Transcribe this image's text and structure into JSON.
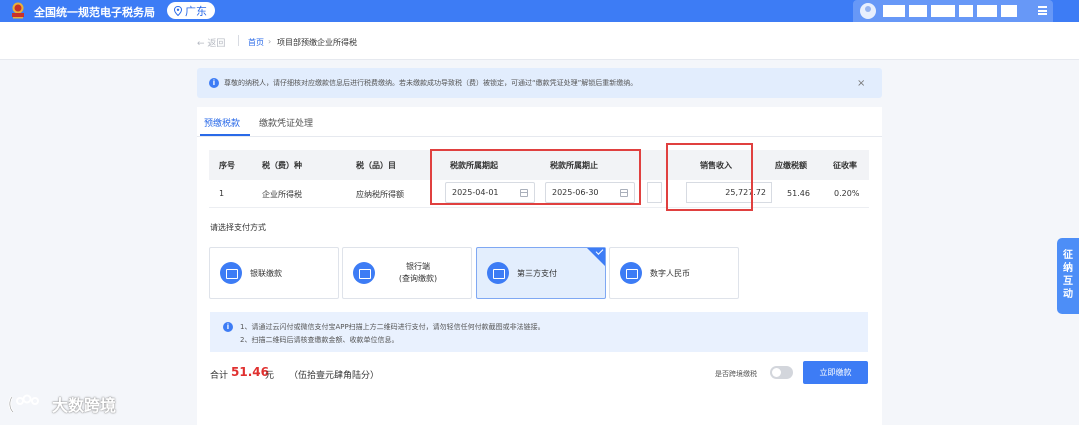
{
  "header": {
    "app_title": "全国统一规范电子税务局",
    "region": "广东",
    "user_name": ""
  },
  "breadcrumb": {
    "back": "← 返回",
    "home": "首页",
    "separator": "›",
    "current": "项目部预缴企业所得税"
  },
  "notice": {
    "text": "尊敬的纳税人，请仔细核对应缴款信息后进行税费缴纳。若未缴款成功导致税（费）被锁定，可通过“缴款凭证处理”解锁后重新缴纳。",
    "close": "×"
  },
  "tabs": [
    {
      "label": "预缴税款",
      "active": true
    },
    {
      "label": "缴款凭证处理",
      "active": false
    }
  ],
  "table": {
    "headers": [
      "序号",
      "税（费）种",
      "税（品）目",
      "税款所属期起",
      "税款所属期止",
      "销售收入",
      "应缴税额",
      "征收率"
    ],
    "row": {
      "index": "1",
      "tax_type": "企业所得税",
      "tax_item": "应纳税所得额",
      "period_start": "2025-04-01",
      "period_end": "2025-06-30",
      "sales_income": "25,727.72",
      "tax_due": "51.46",
      "rate": "0.20%"
    }
  },
  "payment": {
    "label": "请选择支付方式",
    "options": [
      {
        "line1": "银联缴款",
        "line2": "",
        "selected": false
      },
      {
        "line1": "银行端",
        "line2": "(查询缴款)",
        "selected": false
      },
      {
        "line1": "第三方支付",
        "line2": "",
        "selected": true
      },
      {
        "line1": "数字人民币",
        "line2": "",
        "selected": false
      }
    ],
    "tip_lines": [
      "1、请通过云闪付或微信支付宝APP扫描上方二维码进行支付，请勿轻信任何付款截图或非法链接。",
      "2、扫描二维码后请核查缴款金额、收款单位信息。"
    ]
  },
  "footer": {
    "total_label": "合计",
    "total_amount": "51.46",
    "total_unit": "元",
    "total_chinese": "（伍拾壹元肆角陆分）",
    "cross_border_label": "是否跨境缴税",
    "pay_button": "立即缴款"
  },
  "side_tab": {
    "chars": [
      "征",
      "纳",
      "互",
      "动"
    ]
  },
  "watermark": "大数跨境",
  "colors": {
    "primary": "#3d7cf5",
    "highlight": "#e0403f",
    "amount": "#e0302f"
  }
}
